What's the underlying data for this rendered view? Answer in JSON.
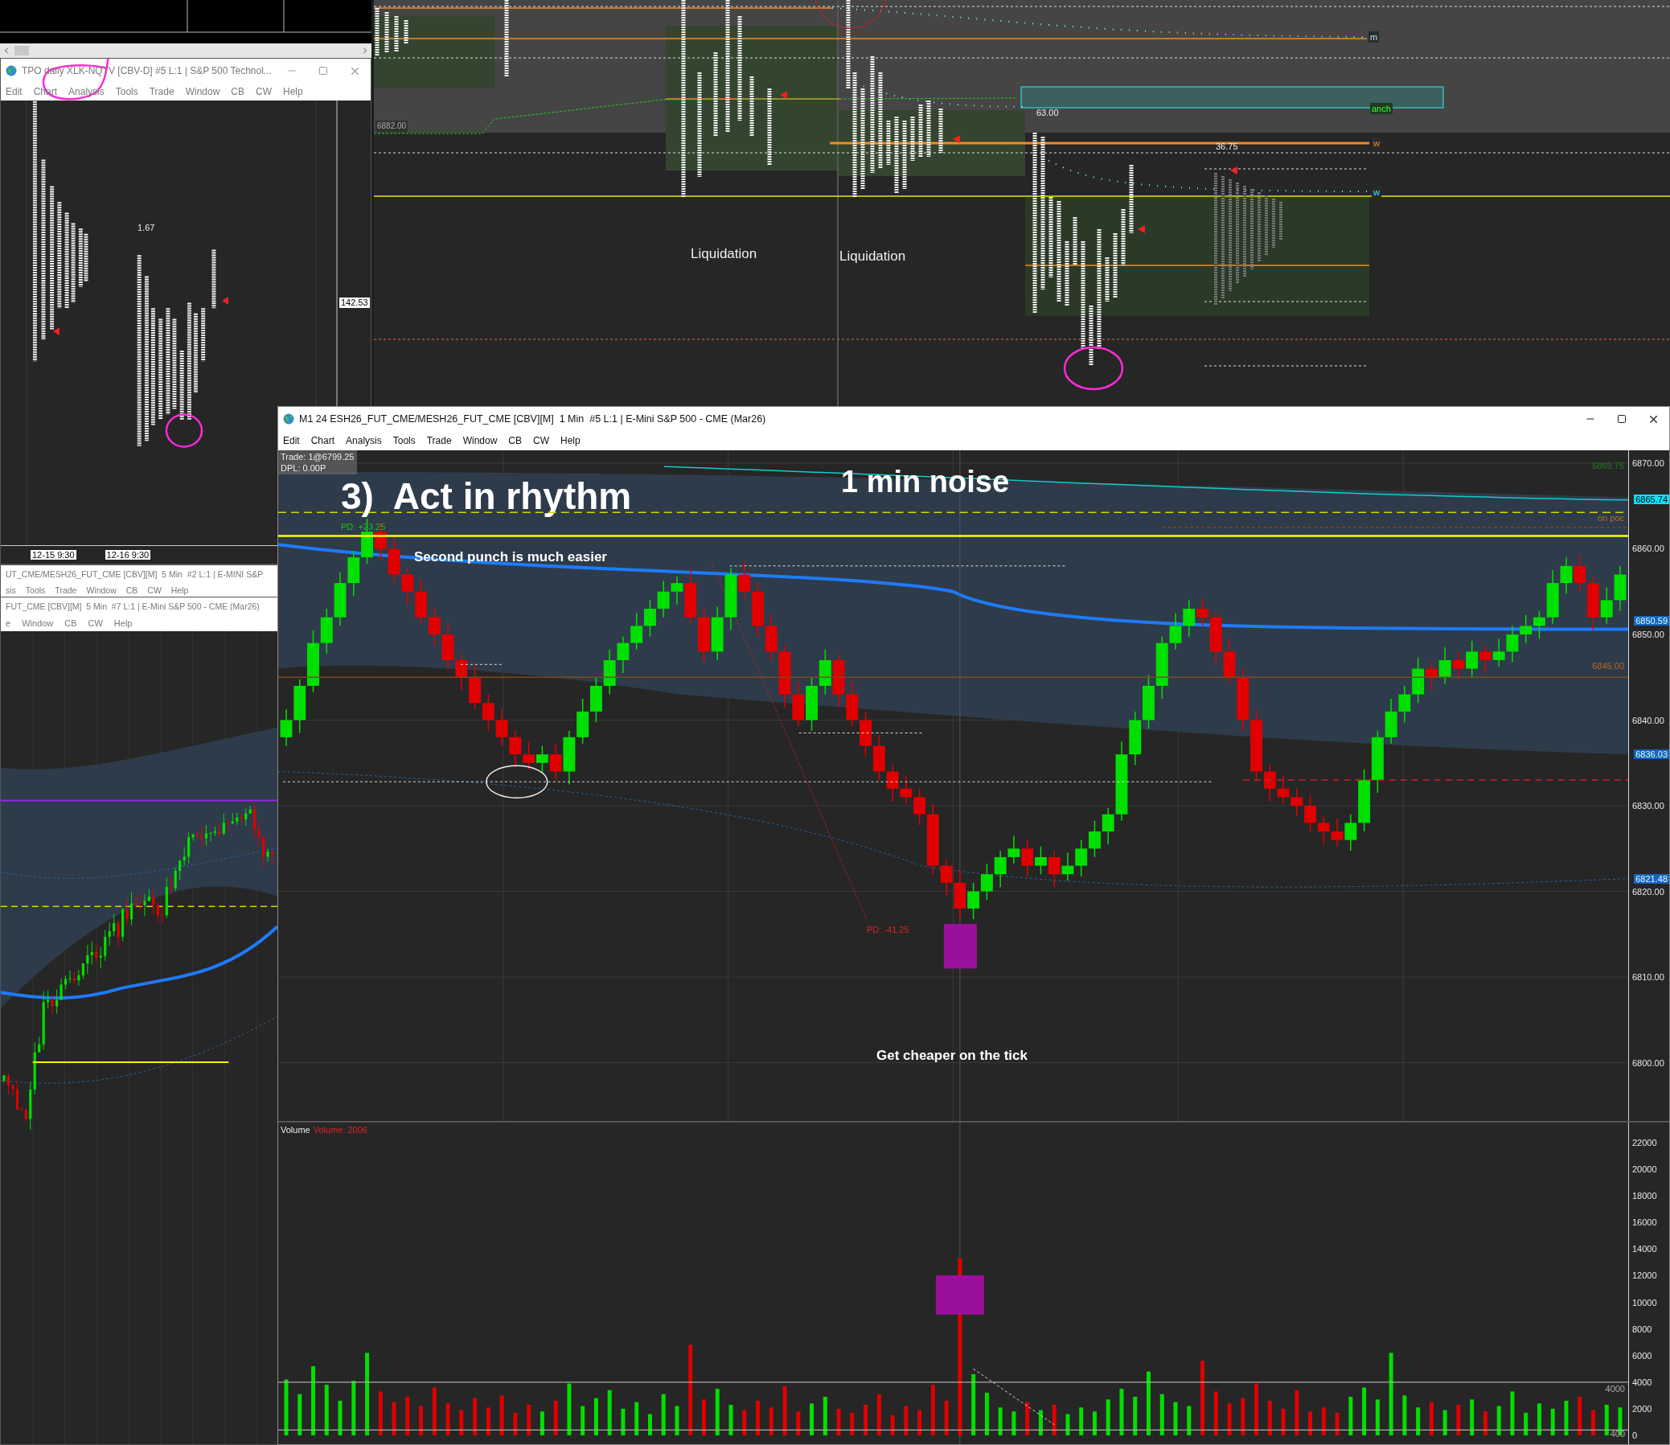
{
  "overview_chart": {
    "labels": [
      {
        "text": "m",
        "kind": "tag"
      },
      {
        "text": "anch",
        "kind": "box"
      },
      {
        "text": "63.00",
        "kind": "value"
      },
      {
        "text": "36.75",
        "kind": "value"
      },
      {
        "text": "w",
        "kind": "tag"
      },
      {
        "text": "w",
        "kind": "tag"
      },
      {
        "text": "Liquidation",
        "kind": "note"
      },
      {
        "text": "Liquidation",
        "kind": "note"
      },
      {
        "text": "6882.00",
        "kind": "price"
      }
    ]
  },
  "tpo_window": {
    "title": "TPO daily XLK-NQTV [CBV-D] #5 L:1 | S&P 500 Technol...",
    "menu": [
      "Edit",
      "Chart",
      "Analysis",
      "Tools",
      "Trade",
      "Window",
      "CB",
      "CW",
      "Help"
    ],
    "profile_value": "1.67",
    "price_tag": "142.53",
    "time_labels": [
      "12-15 9:30",
      "12-16 9:30"
    ]
  },
  "back_window": {
    "title": "UT_CME/MESH26_FUT_CME [CBV][M]  5 Min  #2 L:1 | E-MINI S&P",
    "menu": [
      "sis",
      "Tools",
      "Trade",
      "Window",
      "CB",
      "CW",
      "Help"
    ]
  },
  "five_min_window": {
    "title": "FUT_CME [CBV][M]  5 Min  #7 L:1 | E-Mini S&P 500 - CME (Mar26)",
    "menu": [
      "e",
      "Window",
      "CB",
      "CW",
      "Help"
    ]
  },
  "main_window": {
    "title": "M1 24 ESH26_FUT_CME/MESH26_FUT_CME [CBV][M]  1 Min  #5 L:1 | E-Mini S&P 500 - CME (Mar26)",
    "menu": [
      "Edit",
      "Chart",
      "Analysis",
      "Tools",
      "Trade",
      "Window",
      "CB",
      "CW",
      "Help"
    ],
    "trade_info": [
      "Trade: 1@6799.25",
      "DPL: 0.00P"
    ],
    "annotations": [
      {
        "text": "3)  Act in rhythm",
        "kind": "heading"
      },
      {
        "text": "1 min noise",
        "kind": "heading"
      },
      {
        "text": "PD: +23.25",
        "kind": "pd_up"
      },
      {
        "text": "Second punch is much easier",
        "kind": "note"
      },
      {
        "text": "PD: -41.25",
        "kind": "pd_down"
      },
      {
        "text": "Get cheaper on the tick",
        "kind": "note"
      }
    ],
    "price_chart": {
      "chart_data": {
        "type": "candlestick",
        "ylim": [
          6793.2,
          6871.5
        ],
        "grid": true,
        "yticks": [
          {
            "value": 6870,
            "label": "6870.00"
          },
          {
            "value": 6860,
            "label": "6860.00"
          },
          {
            "value": 6850,
            "label": "6850.00"
          },
          {
            "value": 6840,
            "label": "6840.00"
          },
          {
            "value": 6830,
            "label": "6830.00"
          },
          {
            "value": 6820,
            "label": "6820.00"
          },
          {
            "value": 6810,
            "label": "6810.00"
          },
          {
            "value": 6800,
            "label": "6800.00"
          }
        ],
        "ohlc": [
          [
            6838,
            6841.25,
            6837,
            6840
          ],
          [
            6840,
            6844.75,
            6838.5,
            6844
          ],
          [
            6844,
            6850.5,
            6843.25,
            6849
          ],
          [
            6849,
            6853,
            6847.75,
            6852
          ],
          [
            6852,
            6857.25,
            6851,
            6856
          ],
          [
            6856,
            6859.75,
            6854.5,
            6859
          ],
          [
            6859,
            6863.5,
            6858.25,
            6862
          ],
          [
            6862,
            6863,
            6858.75,
            6860
          ],
          [
            6860,
            6861.25,
            6856,
            6857
          ],
          [
            6857,
            6857.75,
            6853.5,
            6855
          ],
          [
            6855,
            6856.5,
            6851.25,
            6852
          ],
          [
            6852,
            6853,
            6848.75,
            6850
          ],
          [
            6850,
            6851.25,
            6846,
            6847
          ],
          [
            6847,
            6847.75,
            6843.5,
            6845
          ],
          [
            6845,
            6846.5,
            6841.25,
            6842
          ],
          [
            6842,
            6843,
            6838.75,
            6840
          ],
          [
            6840,
            6841.25,
            6837,
            6838
          ],
          [
            6838,
            6838.75,
            6834.5,
            6836
          ],
          [
            6836,
            6837.5,
            6834.25,
            6835
          ],
          [
            6835,
            6837,
            6833.75,
            6836
          ],
          [
            6836,
            6837.25,
            6833,
            6834
          ],
          [
            6834,
            6838.75,
            6832.5,
            6838
          ],
          [
            6838,
            6842.5,
            6837.25,
            6841
          ],
          [
            6841,
            6845,
            6839.75,
            6844
          ],
          [
            6844,
            6848.25,
            6843,
            6847
          ],
          [
            6847,
            6849.75,
            6845.5,
            6849
          ],
          [
            6849,
            6852.5,
            6848.25,
            6851
          ],
          [
            6851,
            6854,
            6849.75,
            6853
          ],
          [
            6853,
            6856.25,
            6852,
            6855
          ],
          [
            6855,
            6856.75,
            6853.5,
            6856
          ],
          [
            6856,
            6857.5,
            6851.25,
            6852
          ],
          [
            6852,
            6853,
            6846.75,
            6848
          ],
          [
            6848,
            6853.25,
            6847,
            6852
          ],
          [
            6852,
            6857.75,
            6850.5,
            6857
          ],
          [
            6857,
            6858.5,
            6854.25,
            6855
          ],
          [
            6855,
            6856,
            6849.75,
            6851
          ],
          [
            6851,
            6852.25,
            6847,
            6848
          ],
          [
            6848,
            6848.75,
            6841.5,
            6843
          ],
          [
            6843,
            6844.5,
            6839.25,
            6840
          ],
          [
            6840,
            6845,
            6838.75,
            6844
          ],
          [
            6844,
            6848.25,
            6843,
            6847
          ],
          [
            6847,
            6847.75,
            6841.5,
            6843
          ],
          [
            6843,
            6844.5,
            6839.25,
            6840
          ],
          [
            6840,
            6841,
            6835.75,
            6837
          ],
          [
            6837,
            6838.25,
            6833,
            6834
          ],
          [
            6834,
            6834.75,
            6830.5,
            6832
          ],
          [
            6832,
            6833.5,
            6830.25,
            6831
          ],
          [
            6831,
            6832,
            6827.75,
            6829
          ],
          [
            6829,
            6830.25,
            6822,
            6823
          ],
          [
            6823,
            6823.75,
            6819.5,
            6821
          ],
          [
            6821,
            6822.5,
            6816.75,
            6818
          ],
          [
            6818,
            6821,
            6816.75,
            6820
          ],
          [
            6820,
            6823.25,
            6819,
            6822
          ],
          [
            6822,
            6824.75,
            6820.5,
            6824
          ],
          [
            6824,
            6826.5,
            6823.25,
            6825
          ],
          [
            6825,
            6826,
            6821.75,
            6823
          ],
          [
            6823,
            6825.25,
            6822,
            6824
          ],
          [
            6824,
            6824.75,
            6820.5,
            6822
          ],
          [
            6822,
            6824.5,
            6821.25,
            6823
          ],
          [
            6823,
            6826,
            6821.75,
            6825
          ],
          [
            6825,
            6828.25,
            6824,
            6827
          ],
          [
            6827,
            6829.75,
            6825.5,
            6829
          ],
          [
            6829,
            6837.5,
            6828.25,
            6836
          ],
          [
            6836,
            6841,
            6834.75,
            6840
          ],
          [
            6840,
            6845.25,
            6839,
            6844
          ],
          [
            6844,
            6849.75,
            6842.5,
            6849
          ],
          [
            6849,
            6852.5,
            6848.25,
            6851
          ],
          [
            6851,
            6854,
            6849.75,
            6853
          ],
          [
            6853,
            6854.25,
            6851,
            6852
          ],
          [
            6852,
            6852.75,
            6846.5,
            6848
          ],
          [
            6848,
            6849.5,
            6844.25,
            6845
          ],
          [
            6845,
            6846,
            6838.75,
            6840
          ],
          [
            6840,
            6841.25,
            6833,
            6834
          ],
          [
            6834,
            6834.75,
            6830.5,
            6832
          ],
          [
            6832,
            6833.5,
            6830.25,
            6831
          ],
          [
            6831,
            6832,
            6828.75,
            6830
          ],
          [
            6830,
            6831.25,
            6827,
            6828
          ],
          [
            6828,
            6828.75,
            6825.5,
            6827
          ],
          [
            6827,
            6828.5,
            6825.25,
            6826
          ],
          [
            6826,
            6829,
            6824.75,
            6828
          ],
          [
            6828,
            6834.25,
            6827,
            6833
          ],
          [
            6833,
            6838.75,
            6831.5,
            6838
          ],
          [
            6838,
            6842.5,
            6837.25,
            6841
          ],
          [
            6841,
            6844,
            6839.75,
            6843
          ],
          [
            6843,
            6847.25,
            6842,
            6846
          ],
          [
            6846,
            6846.75,
            6843.5,
            6845
          ],
          [
            6845,
            6848.5,
            6844.25,
            6847
          ],
          [
            6847,
            6848,
            6844.75,
            6846
          ],
          [
            6846,
            6849.25,
            6845,
            6848
          ],
          [
            6848,
            6848.75,
            6845.5,
            6847
          ],
          [
            6847,
            6849.5,
            6846.25,
            6848
          ],
          [
            6848,
            6851,
            6846.75,
            6850
          ],
          [
            6850,
            6852.25,
            6849,
            6851
          ],
          [
            6851,
            6852.75,
            6849.5,
            6852
          ],
          [
            6852,
            6857.5,
            6851.25,
            6856
          ],
          [
            6856,
            6859,
            6854.75,
            6858
          ],
          [
            6858,
            6859.25,
            6855,
            6856
          ],
          [
            6856,
            6856.75,
            6850.5,
            6852
          ],
          [
            6852,
            6855.5,
            6851.25,
            6854
          ],
          [
            6854,
            6858,
            6852.75,
            6857
          ]
        ]
      }
    },
    "price_markers": [
      {
        "label": "6869.75",
        "kind": "text",
        "color": "#1f7a1f"
      },
      {
        "label": "6865.74",
        "kind": "tag",
        "color": "#00e5ff"
      },
      {
        "label": "on poc",
        "kind": "text",
        "color": "#b07024"
      },
      {
        "label": "6850.59",
        "kind": "tag",
        "color": "#1565c0"
      },
      {
        "label": "6845.00",
        "kind": "text",
        "color": "#b8661e"
      },
      {
        "label": "6836.03",
        "kind": "tag",
        "color": "#1565c0"
      },
      {
        "label": "6821.48",
        "kind": "tag",
        "color": "#1565c0"
      }
    ],
    "volume": {
      "title": "Volume",
      "reading": "Volume: 2006",
      "pane_marks": [
        "4000",
        "400"
      ],
      "chart_data": {
        "type": "bar",
        "ylim": [
          -661,
          23502
        ],
        "yticks": [
          {
            "value": 22000,
            "label": "22000"
          },
          {
            "value": 20000,
            "label": "20000"
          },
          {
            "value": 18000,
            "label": "18000"
          },
          {
            "value": 16000,
            "label": "16000"
          },
          {
            "value": 14000,
            "label": "14000"
          },
          {
            "value": 12000,
            "label": "12000"
          },
          {
            "value": 10000,
            "label": "10000"
          },
          {
            "value": 8000,
            "label": "8000"
          },
          {
            "value": 6000,
            "label": "6000"
          },
          {
            "value": 4000,
            "label": "4000"
          },
          {
            "value": 2000,
            "label": "2000"
          },
          {
            "value": 0,
            "label": "0"
          }
        ],
        "values": [
          4200,
          3100,
          5200,
          3800,
          2600,
          4100,
          6200,
          3300,
          2500,
          2900,
          2200,
          3600,
          2400,
          1900,
          2800,
          2100,
          3000,
          1700,
          2300,
          1800,
          2600,
          3900,
          2200,
          2800,
          3400,
          2000,
          2500,
          1600,
          3100,
          2200,
          6800,
          2700,
          3500,
          2300,
          1900,
          2600,
          2100,
          3700,
          1800,
          2400,
          2900,
          2000,
          1700,
          2300,
          3100,
          1500,
          2200,
          1900,
          3800,
          2600,
          13300,
          4600,
          3200,
          2100,
          1800,
          2500,
          1900,
          2300,
          1600,
          2100,
          1800,
          2700,
          3500,
          2900,
          4800,
          3100,
          2500,
          2200,
          5600,
          3300,
          2400,
          2800,
          3900,
          2600,
          2000,
          3400,
          1800,
          2100,
          1700,
          2900,
          3600,
          2700,
          6200,
          3000,
          2100,
          2500,
          1900,
          2300,
          2700,
          1800,
          2200,
          3300,
          1700,
          2400,
          2000,
          2600,
          2900,
          1900,
          2300,
          2100
        ]
      }
    }
  }
}
